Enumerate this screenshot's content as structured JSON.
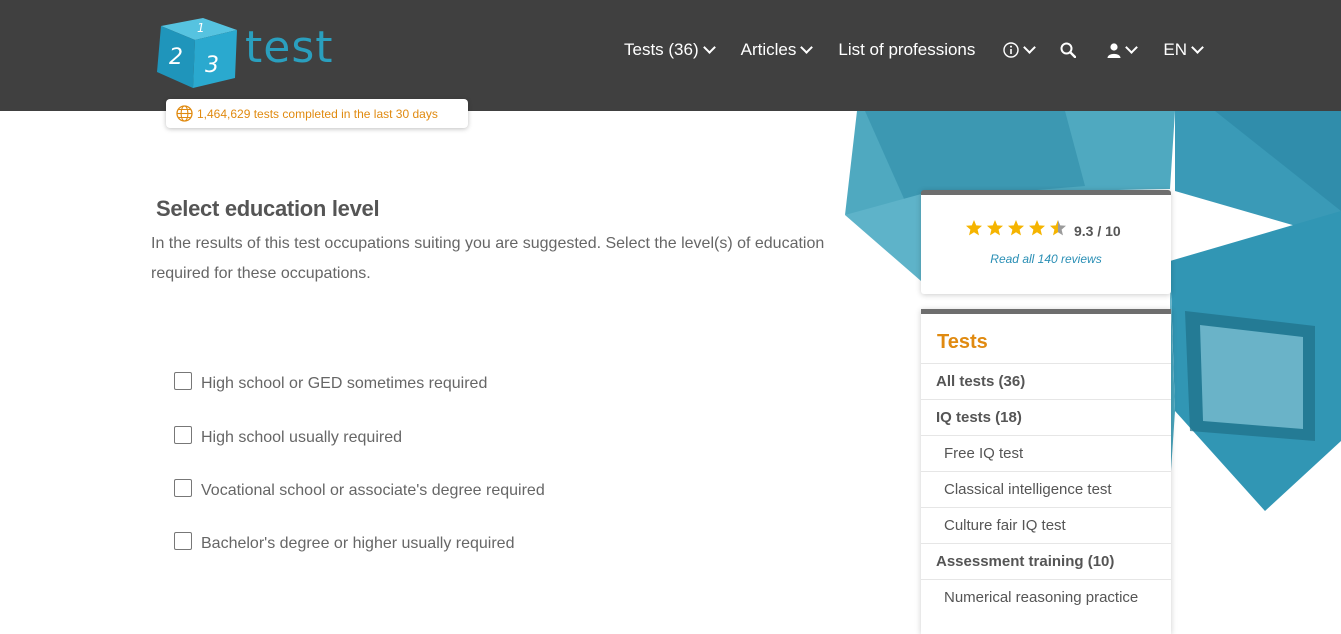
{
  "header": {
    "logo_word": "test",
    "nav": [
      {
        "label": "Tests (36)",
        "has_dropdown": true
      },
      {
        "label": "Articles",
        "has_dropdown": true
      },
      {
        "label": "List of professions",
        "has_dropdown": false
      }
    ],
    "icons": [
      "info-icon",
      "search-icon",
      "user-icon"
    ],
    "language": "EN",
    "counter_text": "1,464,629 tests completed in the last 30 days"
  },
  "main": {
    "title": "Select education level",
    "description": "In the results of this test occupations suiting you are suggested. Select the level(s) of education required for these occupations.",
    "options": [
      {
        "label": "High school or GED sometimes required",
        "checked": false
      },
      {
        "label": "High school usually required",
        "checked": false
      },
      {
        "label": "Vocational school or associate's degree required",
        "checked": false
      },
      {
        "label": "Bachelor's degree or higher usually required",
        "checked": false
      }
    ]
  },
  "rating": {
    "stars": 4.5,
    "score": "9.3 / 10",
    "reviews_link": "Read all 140 reviews"
  },
  "tests_panel": {
    "title": "Tests",
    "items": [
      {
        "label": "All tests (36)",
        "type": "group"
      },
      {
        "label": "IQ tests (18)",
        "type": "group"
      },
      {
        "label": "Free IQ test",
        "type": "sub"
      },
      {
        "label": "Classical intelligence test",
        "type": "sub"
      },
      {
        "label": "Culture fair IQ test",
        "type": "sub"
      },
      {
        "label": "Assessment training (10)",
        "type": "group"
      },
      {
        "label": "Numerical reasoning practice",
        "type": "sub"
      }
    ]
  },
  "colors": {
    "header_bg": "#404040",
    "accent_orange": "#e08a10",
    "brand_teal": "#2a9fbe",
    "link_blue": "#2a8fb5"
  }
}
